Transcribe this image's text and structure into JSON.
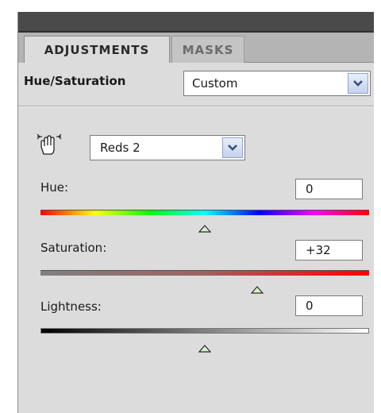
{
  "tabs": [
    {
      "label": "ADJUSTMENTS",
      "active": true
    },
    {
      "label": "MASKS",
      "active": false
    }
  ],
  "preset": {
    "label": "Hue/Saturation",
    "value": "Custom"
  },
  "edit": {
    "value": "Reds 2"
  },
  "sliders": [
    {
      "label": "Hue:",
      "value": "0",
      "position": 0.5
    },
    {
      "label": "Saturation:",
      "value": "+32",
      "position": 0.66
    },
    {
      "label": "Lightness:",
      "value": "0",
      "position": 0.5
    }
  ],
  "icons": {
    "dropdown": "chevron-down-icon",
    "targeted_adjustment": "hand-icon",
    "slider_thumb": "triangle-up-icon"
  },
  "colors": {
    "panel_bg": "#dcdcdc",
    "tab_bar_bg": "#b4b4b4",
    "dropdown_button": "#c5d3ee",
    "saturation_end": "#ff0000"
  }
}
